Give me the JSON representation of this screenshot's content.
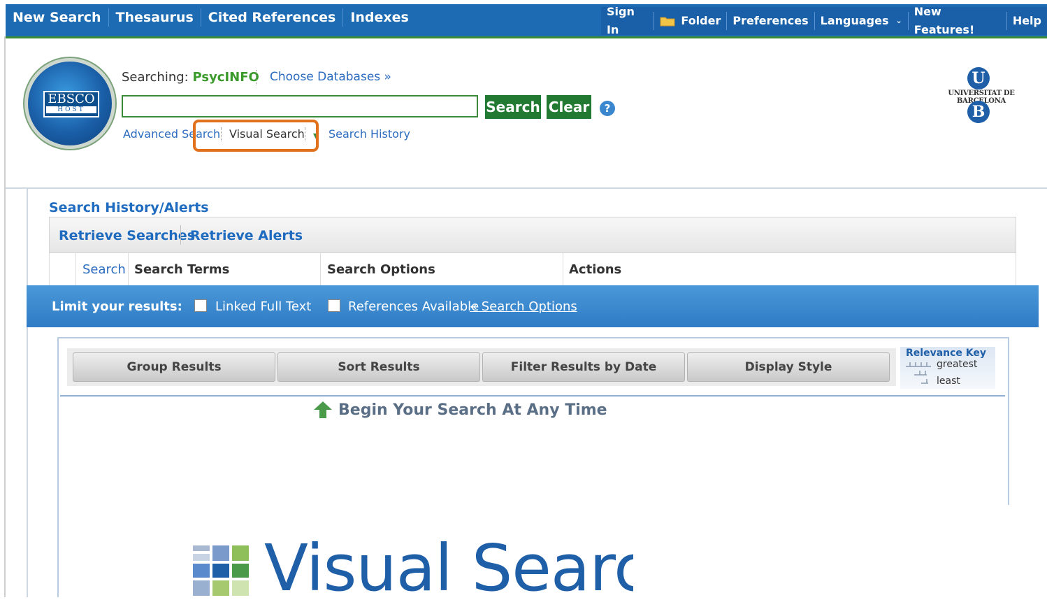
{
  "topnav": {
    "left": [
      "New Search",
      "Thesaurus",
      "Cited References",
      "Indexes"
    ],
    "right": [
      "Sign In",
      "Folder",
      "Preferences",
      "Languages",
      "New Features!",
      "Help"
    ]
  },
  "logo": {
    "name": "EBSCO",
    "sub": "HOST"
  },
  "search": {
    "searching_label": "Searching:",
    "database": "PsycINFO",
    "choose_databases": "Choose Databases »",
    "input_value": "",
    "search_button": "Search",
    "clear_button": "Clear",
    "help": "?",
    "links": {
      "advanced": "Advanced Search",
      "visual": "Visual Search",
      "history": "Search History"
    }
  },
  "university": {
    "letter_top": "U",
    "name": "UNIVERSITAT DE BARCELONA",
    "letter_bottom": "B"
  },
  "history": {
    "title": "Search History/Alerts",
    "retrieve_searches": "Retrieve Searches",
    "retrieve_alerts": "Retrieve Alerts",
    "columns": {
      "search": "Search",
      "terms": "Search Terms",
      "options": "Search Options",
      "actions": "Actions"
    }
  },
  "limits": {
    "label": "Limit your results:",
    "linked_full_text": "Linked Full Text",
    "references_available": "References Available",
    "search_options_link": "« Search Options"
  },
  "results": {
    "toolbar": [
      "Group Results",
      "Sort Results",
      "Filter Results by Date",
      "Display Style"
    ],
    "relevance_key": {
      "title": "Relevance Key",
      "greatest": "greatest",
      "least": "least"
    },
    "begin": "Begin Your Search At Any Time"
  },
  "visual_search_logo": {
    "text": "Visual Search"
  },
  "colors": {
    "nav_blue": "#1d6bb3",
    "button_green": "#227a32",
    "highlight_orange": "#e2711d",
    "limit_blue": "#2f7bc5"
  }
}
